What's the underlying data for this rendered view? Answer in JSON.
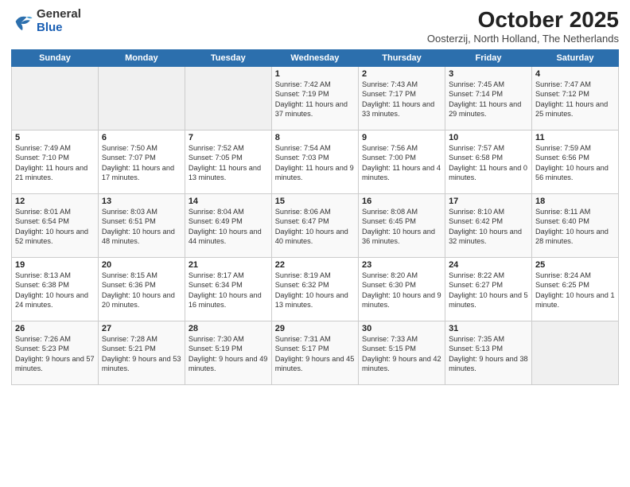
{
  "header": {
    "logo_line1": "General",
    "logo_line2": "Blue",
    "title": "October 2025",
    "subtitle": "Oosterzij, North Holland, The Netherlands"
  },
  "calendar": {
    "days_of_week": [
      "Sunday",
      "Monday",
      "Tuesday",
      "Wednesday",
      "Thursday",
      "Friday",
      "Saturday"
    ],
    "weeks": [
      [
        {
          "day": "",
          "sunrise": "",
          "sunset": "",
          "daylight": ""
        },
        {
          "day": "",
          "sunrise": "",
          "sunset": "",
          "daylight": ""
        },
        {
          "day": "",
          "sunrise": "",
          "sunset": "",
          "daylight": ""
        },
        {
          "day": "1",
          "sunrise": "Sunrise: 7:42 AM",
          "sunset": "Sunset: 7:19 PM",
          "daylight": "Daylight: 11 hours and 37 minutes."
        },
        {
          "day": "2",
          "sunrise": "Sunrise: 7:43 AM",
          "sunset": "Sunset: 7:17 PM",
          "daylight": "Daylight: 11 hours and 33 minutes."
        },
        {
          "day": "3",
          "sunrise": "Sunrise: 7:45 AM",
          "sunset": "Sunset: 7:14 PM",
          "daylight": "Daylight: 11 hours and 29 minutes."
        },
        {
          "day": "4",
          "sunrise": "Sunrise: 7:47 AM",
          "sunset": "Sunset: 7:12 PM",
          "daylight": "Daylight: 11 hours and 25 minutes."
        }
      ],
      [
        {
          "day": "5",
          "sunrise": "Sunrise: 7:49 AM",
          "sunset": "Sunset: 7:10 PM",
          "daylight": "Daylight: 11 hours and 21 minutes."
        },
        {
          "day": "6",
          "sunrise": "Sunrise: 7:50 AM",
          "sunset": "Sunset: 7:07 PM",
          "daylight": "Daylight: 11 hours and 17 minutes."
        },
        {
          "day": "7",
          "sunrise": "Sunrise: 7:52 AM",
          "sunset": "Sunset: 7:05 PM",
          "daylight": "Daylight: 11 hours and 13 minutes."
        },
        {
          "day": "8",
          "sunrise": "Sunrise: 7:54 AM",
          "sunset": "Sunset: 7:03 PM",
          "daylight": "Daylight: 11 hours and 9 minutes."
        },
        {
          "day": "9",
          "sunrise": "Sunrise: 7:56 AM",
          "sunset": "Sunset: 7:00 PM",
          "daylight": "Daylight: 11 hours and 4 minutes."
        },
        {
          "day": "10",
          "sunrise": "Sunrise: 7:57 AM",
          "sunset": "Sunset: 6:58 PM",
          "daylight": "Daylight: 11 hours and 0 minutes."
        },
        {
          "day": "11",
          "sunrise": "Sunrise: 7:59 AM",
          "sunset": "Sunset: 6:56 PM",
          "daylight": "Daylight: 10 hours and 56 minutes."
        }
      ],
      [
        {
          "day": "12",
          "sunrise": "Sunrise: 8:01 AM",
          "sunset": "Sunset: 6:54 PM",
          "daylight": "Daylight: 10 hours and 52 minutes."
        },
        {
          "day": "13",
          "sunrise": "Sunrise: 8:03 AM",
          "sunset": "Sunset: 6:51 PM",
          "daylight": "Daylight: 10 hours and 48 minutes."
        },
        {
          "day": "14",
          "sunrise": "Sunrise: 8:04 AM",
          "sunset": "Sunset: 6:49 PM",
          "daylight": "Daylight: 10 hours and 44 minutes."
        },
        {
          "day": "15",
          "sunrise": "Sunrise: 8:06 AM",
          "sunset": "Sunset: 6:47 PM",
          "daylight": "Daylight: 10 hours and 40 minutes."
        },
        {
          "day": "16",
          "sunrise": "Sunrise: 8:08 AM",
          "sunset": "Sunset: 6:45 PM",
          "daylight": "Daylight: 10 hours and 36 minutes."
        },
        {
          "day": "17",
          "sunrise": "Sunrise: 8:10 AM",
          "sunset": "Sunset: 6:42 PM",
          "daylight": "Daylight: 10 hours and 32 minutes."
        },
        {
          "day": "18",
          "sunrise": "Sunrise: 8:11 AM",
          "sunset": "Sunset: 6:40 PM",
          "daylight": "Daylight: 10 hours and 28 minutes."
        }
      ],
      [
        {
          "day": "19",
          "sunrise": "Sunrise: 8:13 AM",
          "sunset": "Sunset: 6:38 PM",
          "daylight": "Daylight: 10 hours and 24 minutes."
        },
        {
          "day": "20",
          "sunrise": "Sunrise: 8:15 AM",
          "sunset": "Sunset: 6:36 PM",
          "daylight": "Daylight: 10 hours and 20 minutes."
        },
        {
          "day": "21",
          "sunrise": "Sunrise: 8:17 AM",
          "sunset": "Sunset: 6:34 PM",
          "daylight": "Daylight: 10 hours and 16 minutes."
        },
        {
          "day": "22",
          "sunrise": "Sunrise: 8:19 AM",
          "sunset": "Sunset: 6:32 PM",
          "daylight": "Daylight: 10 hours and 13 minutes."
        },
        {
          "day": "23",
          "sunrise": "Sunrise: 8:20 AM",
          "sunset": "Sunset: 6:30 PM",
          "daylight": "Daylight: 10 hours and 9 minutes."
        },
        {
          "day": "24",
          "sunrise": "Sunrise: 8:22 AM",
          "sunset": "Sunset: 6:27 PM",
          "daylight": "Daylight: 10 hours and 5 minutes."
        },
        {
          "day": "25",
          "sunrise": "Sunrise: 8:24 AM",
          "sunset": "Sunset: 6:25 PM",
          "daylight": "Daylight: 10 hours and 1 minute."
        }
      ],
      [
        {
          "day": "26",
          "sunrise": "Sunrise: 7:26 AM",
          "sunset": "Sunset: 5:23 PM",
          "daylight": "Daylight: 9 hours and 57 minutes."
        },
        {
          "day": "27",
          "sunrise": "Sunrise: 7:28 AM",
          "sunset": "Sunset: 5:21 PM",
          "daylight": "Daylight: 9 hours and 53 minutes."
        },
        {
          "day": "28",
          "sunrise": "Sunrise: 7:30 AM",
          "sunset": "Sunset: 5:19 PM",
          "daylight": "Daylight: 9 hours and 49 minutes."
        },
        {
          "day": "29",
          "sunrise": "Sunrise: 7:31 AM",
          "sunset": "Sunset: 5:17 PM",
          "daylight": "Daylight: 9 hours and 45 minutes."
        },
        {
          "day": "30",
          "sunrise": "Sunrise: 7:33 AM",
          "sunset": "Sunset: 5:15 PM",
          "daylight": "Daylight: 9 hours and 42 minutes."
        },
        {
          "day": "31",
          "sunrise": "Sunrise: 7:35 AM",
          "sunset": "Sunset: 5:13 PM",
          "daylight": "Daylight: 9 hours and 38 minutes."
        },
        {
          "day": "",
          "sunrise": "",
          "sunset": "",
          "daylight": ""
        }
      ]
    ]
  }
}
